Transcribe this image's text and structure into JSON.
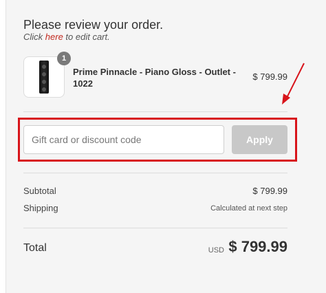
{
  "header": {
    "title": "Please review your order.",
    "edit_prefix": "Click ",
    "edit_link": "here",
    "edit_suffix": " to edit cart."
  },
  "product": {
    "name": "Prime Pinnacle - Piano Gloss - Outlet - 1022",
    "price": "$ 799.99",
    "quantity": "1"
  },
  "discount": {
    "placeholder": "Gift card or discount code",
    "value": "",
    "apply_label": "Apply"
  },
  "summary": {
    "subtotal_label": "Subtotal",
    "subtotal_value": "$ 799.99",
    "shipping_label": "Shipping",
    "shipping_value": "Calculated at next step",
    "total_label": "Total",
    "currency": "USD",
    "total_value": "$ 799.99"
  },
  "colors": {
    "link": "#c22b21",
    "highlight": "#d8141b",
    "apply_disabled": "#c8c8c8"
  }
}
